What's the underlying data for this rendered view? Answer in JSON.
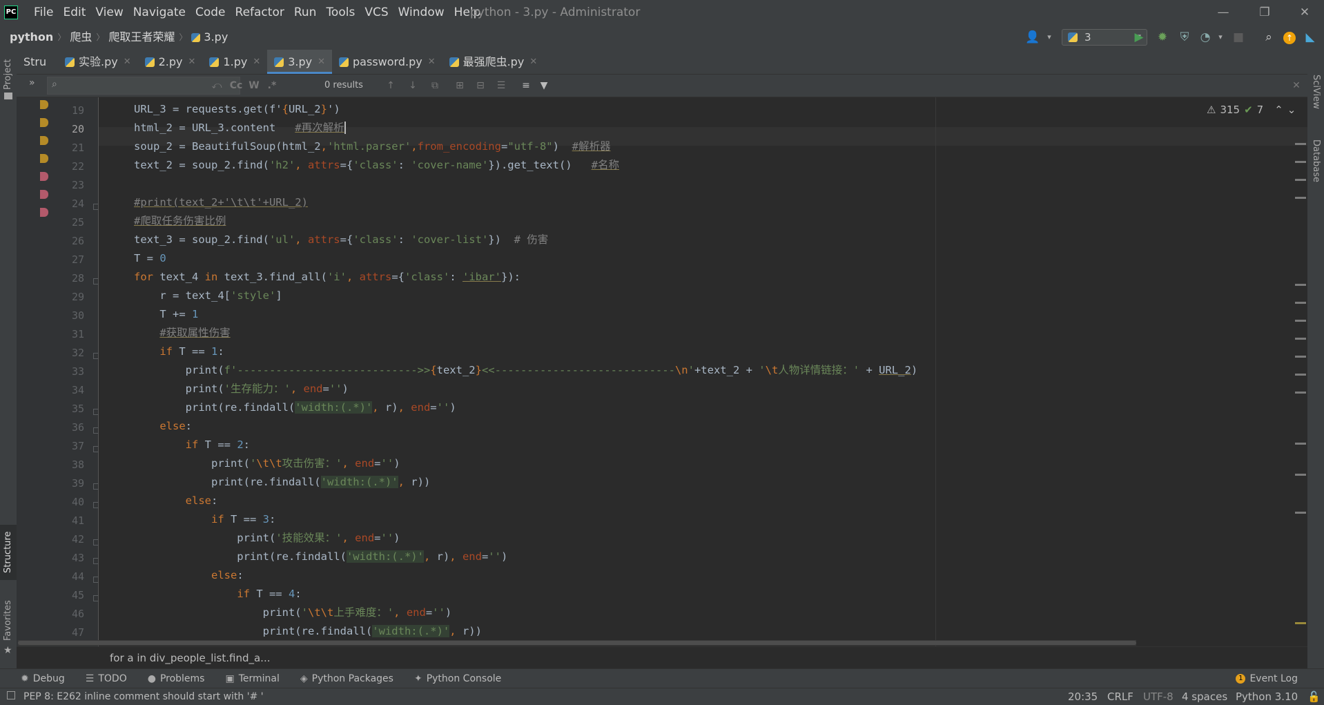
{
  "window": {
    "menu": [
      "File",
      "Edit",
      "View",
      "Navigate",
      "Code",
      "Refactor",
      "Run",
      "Tools",
      "VCS",
      "Window",
      "Help"
    ],
    "title": "python - 3.py - Administrator"
  },
  "navbar": {
    "breadcrumb": [
      "python",
      "爬虫",
      "爬取王者荣耀",
      "3.py"
    ],
    "run_config": "3"
  },
  "tool_strips": {
    "project": "Project",
    "structure": "Structure",
    "favorites": "Favorites",
    "sciview": "SciView",
    "database": "Database"
  },
  "tabs": {
    "structure": "Stru",
    "files": [
      "实验.py",
      "2.py",
      "1.py",
      "3.py",
      "password.py",
      "最强爬虫.py"
    ],
    "active": "3.py"
  },
  "find": {
    "query": "",
    "results": "0 results",
    "toggles": [
      "Cc",
      "W",
      ".*"
    ]
  },
  "editor": {
    "line_numbers": [
      "19",
      "20",
      "21",
      "22",
      "23",
      "24",
      "25",
      "26",
      "27",
      "28",
      "29",
      "30",
      "31",
      "32",
      "33",
      "34",
      "35",
      "36",
      "37",
      "38",
      "39",
      "40",
      "41",
      "42",
      "43",
      "44",
      "45",
      "46",
      "47"
    ],
    "current_line": "20",
    "warnings": "315",
    "weak_warnings": "7"
  },
  "breadcrumb_bottom": "for a in div_people_list.find_a...",
  "tool_windows": [
    "Debug",
    "TODO",
    "Problems",
    "Terminal",
    "Python Packages",
    "Python Console"
  ],
  "event_log": "Event Log",
  "event_count": "1",
  "status": {
    "message": "PEP 8: E262 inline comment should start with '# '",
    "position": "20:35",
    "line_sep": "CRLF",
    "encoding": "UTF-8",
    "indent": "4 spaces",
    "interpreter": "Python 3.10"
  }
}
